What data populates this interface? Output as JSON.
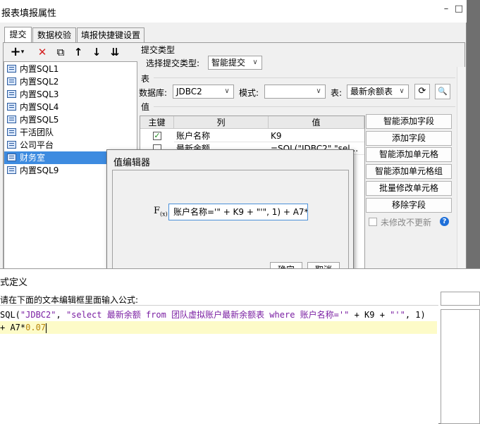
{
  "main_dialog": {
    "title": "报表填报属性",
    "tabs": [
      "提交",
      "数据校验",
      "填报快捷键设置"
    ],
    "toolbar_icons": [
      "add-icon",
      "delete-icon",
      "copy-icon",
      "move-up-icon",
      "move-down-icon",
      "move-bottom-icon"
    ],
    "toolbar_glyphs": {
      "add": "+",
      "add_arrow": "▾",
      "delete": "✕",
      "copy": "⧉",
      "up": "↑",
      "down": "↓",
      "bottom": "⇊"
    },
    "sql_items": [
      "内置SQL1",
      "内置SQL2",
      "内置SQL3",
      "内置SQL4",
      "内置SQL5",
      "干活团队",
      "公司平台",
      "财务室",
      "内置SQL9"
    ],
    "selected_index": 7,
    "submit_type": {
      "section_label": "提交类型",
      "label": "选择提交类型:",
      "value": "智能提交"
    },
    "table_section": {
      "section_label": "表",
      "db_label": "数据库:",
      "db_value": "JDBC2",
      "schema_label": "模式:",
      "schema_value": "",
      "table_label": "表:",
      "table_value": "最新余额表"
    },
    "value_section": {
      "section_label": "值",
      "headers": [
        "主键",
        "列",
        "值"
      ],
      "rows": [
        {
          "key": true,
          "column": "账户名称",
          "value": "K9"
        },
        {
          "key": false,
          "column": "最新余额",
          "value": "=SQL(\"JDBC2\",\"sel..."
        }
      ]
    },
    "actions": [
      "智能添加字段",
      "添加字段",
      "智能添加单元格",
      "智能添加单元格组",
      "批量修改单元格",
      "移除字段"
    ],
    "unchanged_checkbox": "未修改不更新",
    "help_icon": "?",
    "dropdown_arrow": "∨",
    "refresh_icon": "⟳",
    "preview_icon": "🔍",
    "window_buttons": {
      "minimize": "–",
      "maximize": "□"
    }
  },
  "value_editor": {
    "title": "值编辑器",
    "fx_label": "F",
    "fx_sub": "(x)",
    "formula": "账户名称='\" + K9 + \"'\", 1) + A7*0.07",
    "ok": "确定",
    "cancel": "取消"
  },
  "formula_dialog": {
    "title": "式定义",
    "prompt": "请在下面的文本编辑框里面输入公式:",
    "code_line1_prefix": "SQL(",
    "code_line1_str1": "\"JDBC2\"",
    "code_line1_mid": ", ",
    "code_line1_str2": "\"select 最新余额 from 团队虚拟账户最新余额表 where 账户名称='\"",
    "code_line1_mid2": " + K9 + ",
    "code_line1_str3": "\"'\"",
    "code_line1_tail": ", 1)",
    "code_line2_prefix": "+ A7*",
    "code_line2_num": "0.07"
  }
}
